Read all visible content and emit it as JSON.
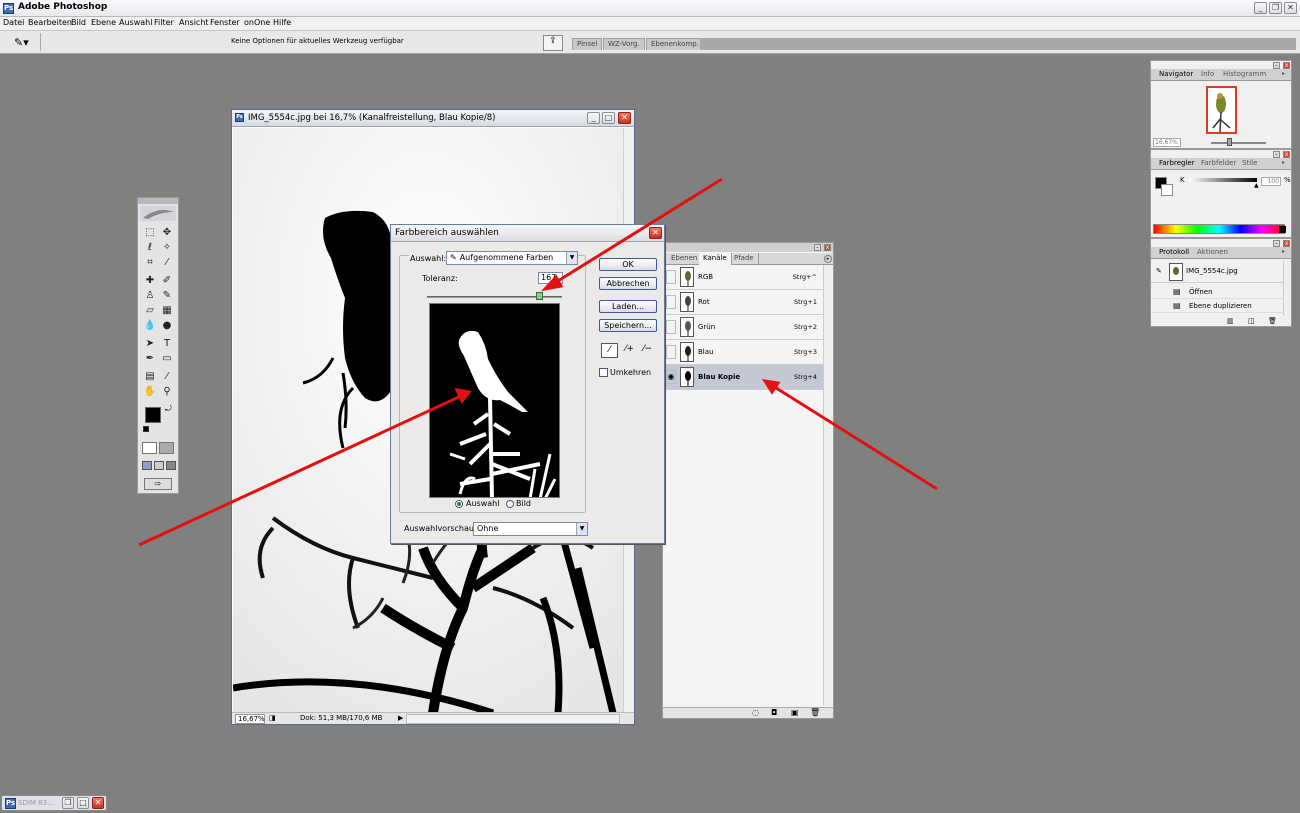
{
  "app": {
    "title": "Adobe Photoshop",
    "logo": "Ps"
  },
  "menu": [
    "Datei",
    "Bearbeiten",
    "Bild",
    "Ebene",
    "Auswahl",
    "Filter",
    "Ansicht",
    "Fenster",
    "onOne",
    "Hilfe"
  ],
  "options": {
    "message": "Keine Optionen für aktuelles Werkzeug verfügbar"
  },
  "palette_well": {
    "tabs": [
      "Pinsel",
      "WZ-Vorg.",
      "Ebenenkomp."
    ]
  },
  "document": {
    "title": "IMG_5554c.jpg bei 16,7% (Kanalfreistellung, Blau Kopie/8)",
    "zoom": "16,67%",
    "doc_info": "Dok: 51,3 MB/170,6 MB"
  },
  "dialog": {
    "title": "Farbbereich auswählen",
    "auswahl_label": "Auswahl:",
    "auswahl_value": "Aufgenommene Farben",
    "toleranz_label": "Toleranz:",
    "toleranz_value": "167",
    "toleranz_fraction": 0.83,
    "radio_selection": "Auswahl",
    "radio_image": "Bild",
    "radio_checked": "Auswahl",
    "preview_label": "Auswahlvorschau:",
    "preview_value": "Ohne",
    "invert_label": "Umkehren",
    "invert_checked": false,
    "buttons": {
      "ok": "OK",
      "cancel": "Abbrechen",
      "load": "Laden...",
      "save": "Speichern..."
    }
  },
  "channels": {
    "tabs": [
      "Ebenen",
      "Kanäle",
      "Pfade"
    ],
    "active_tab": "Kanäle",
    "rows": [
      {
        "name": "RGB",
        "shortcut": "Strg+^"
      },
      {
        "name": "Rot",
        "shortcut": "Strg+1"
      },
      {
        "name": "Grün",
        "shortcut": "Strg+2"
      },
      {
        "name": "Blau",
        "shortcut": "Strg+3"
      },
      {
        "name": "Blau Kopie",
        "shortcut": "Strg+4"
      }
    ],
    "selected": "Blau Kopie"
  },
  "navigator": {
    "tabs": [
      "Navigator",
      "Info",
      "Histogramm"
    ],
    "zoom": "16,67%"
  },
  "color": {
    "tabs": [
      "Farbregler",
      "Farbfelder",
      "Stile"
    ],
    "channel": "K",
    "value": "100",
    "unit": "%"
  },
  "history": {
    "tabs": [
      "Protokoll",
      "Aktionen"
    ],
    "snapshot": "IMG_5554c.jpg",
    "steps": [
      "Öffnen",
      "Ebene duplizieren"
    ]
  },
  "taskbar": {
    "label": "SDIM 83..."
  },
  "colors": {
    "arrow": "#e41010",
    "selected_row": "#c4c8d4"
  }
}
